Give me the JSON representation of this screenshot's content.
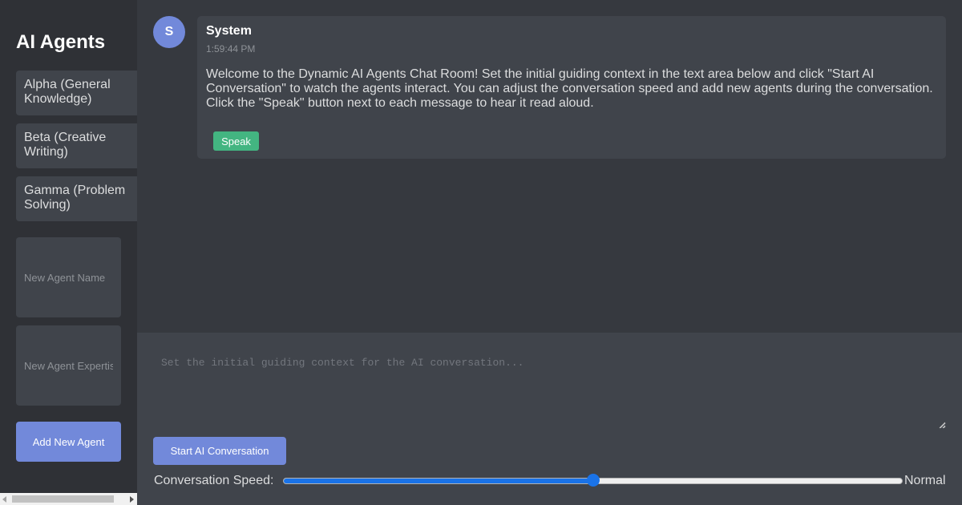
{
  "sidebar": {
    "title": "AI Agents",
    "agents": [
      {
        "label": "Alpha (General Knowledge)"
      },
      {
        "label": "Beta (Creative Writing)"
      },
      {
        "label": "Gamma (Problem Solving)"
      }
    ],
    "new_agent_name_placeholder": "New Agent Name",
    "new_agent_expertise_placeholder": "New Agent Expertise",
    "add_button_label": "Add New Agent"
  },
  "chat": {
    "messages": [
      {
        "avatar_letter": "S",
        "sender": "System",
        "time": "1:59:44 PM",
        "text": "Welcome to the Dynamic AI Agents Chat Room! Set the initial guiding context in the text area below and click \"Start AI Conversation\" to watch the agents interact. You can adjust the conversation speed and add new agents during the conversation. Click the \"Speak\" button next to each message to hear it read aloud.",
        "speak_label": "Speak"
      }
    ]
  },
  "controls": {
    "context_placeholder": "Set the initial guiding context for the AI conversation...",
    "start_button_label": "Start AI Conversation",
    "speed_label": "Conversation Speed:",
    "speed_value_label": "Normal",
    "speed_level": 0.5
  },
  "colors": {
    "accent": "#7289da",
    "speak_green": "#43b581",
    "slider_blue": "#1a73e8"
  }
}
